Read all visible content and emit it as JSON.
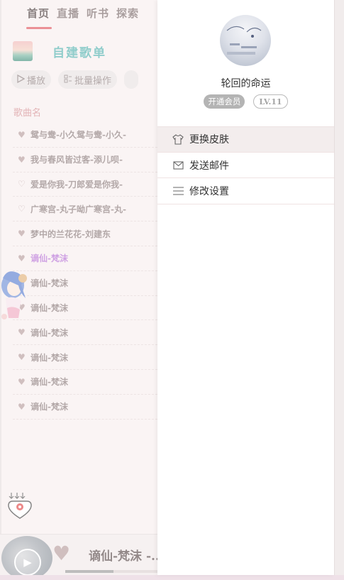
{
  "nav": {
    "tabs": [
      {
        "label": "首页",
        "active": true
      },
      {
        "label": "直播"
      },
      {
        "label": "听书"
      },
      {
        "label": "探索"
      }
    ]
  },
  "playlist": {
    "title": "自建歌单"
  },
  "actions": {
    "play_label": "播放",
    "batch_label": "批量操作"
  },
  "list": {
    "column_header": "歌曲名",
    "songs": [
      {
        "title": "鸳与鸯-小久鸳与鸯-小久-",
        "liked": true
      },
      {
        "title": "我与春风皆过客-添儿呗-",
        "liked": true
      },
      {
        "title": "爱是你我-刀郎爱是你我-",
        "liked": false
      },
      {
        "title": "广寒宫-丸子呦广寒宫-丸-",
        "liked": false
      },
      {
        "title": "梦中的兰花花-刘建东",
        "liked": true
      },
      {
        "title": "谪仙-梵沫",
        "liked": true,
        "playing": true
      },
      {
        "title": "谪仙-梵沫",
        "liked": true
      },
      {
        "title": "谪仙-梵沫",
        "liked": true
      },
      {
        "title": "谪仙-梵沫",
        "liked": true
      },
      {
        "title": "谪仙-梵沫",
        "liked": true
      },
      {
        "title": "谪仙-梵沫",
        "liked": true
      },
      {
        "title": "谪仙-梵沫",
        "liked": true
      }
    ]
  },
  "player": {
    "now_playing": "谪仙-梵沫 -...",
    "progress": 0.45
  },
  "drawer": {
    "username": "轮回的命运",
    "vip_label": "开通会员",
    "level_label": "LV.11",
    "menu": [
      {
        "label": "更换皮肤",
        "icon": "shirt-icon"
      },
      {
        "label": "发送邮件",
        "icon": "mail-icon"
      },
      {
        "label": "修改设置",
        "icon": "menu-lines-icon"
      }
    ]
  },
  "colors": {
    "accent_red": "#e0555f",
    "playlist_teal": "#55b2b0",
    "playing_purple": "#b56fd4",
    "heart_tone": "#b79d9d"
  }
}
